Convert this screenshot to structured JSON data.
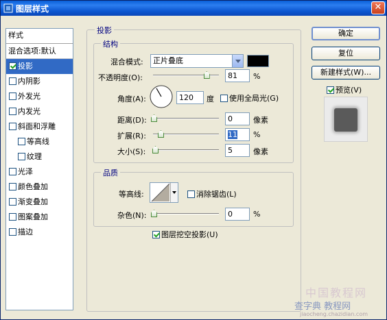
{
  "window": {
    "title": "图层样式",
    "close_glyph": "✕"
  },
  "style_list": {
    "header": "样式",
    "blend_options": "混合选项:默认",
    "items": [
      {
        "label": "投影",
        "checked": true,
        "active": true,
        "indent": false
      },
      {
        "label": "内阴影",
        "checked": false,
        "active": false,
        "indent": false
      },
      {
        "label": "外发光",
        "checked": false,
        "active": false,
        "indent": false
      },
      {
        "label": "内发光",
        "checked": false,
        "active": false,
        "indent": false
      },
      {
        "label": "斜面和浮雕",
        "checked": false,
        "active": false,
        "indent": false
      },
      {
        "label": "等高线",
        "checked": false,
        "active": false,
        "indent": true
      },
      {
        "label": "纹理",
        "checked": false,
        "active": false,
        "indent": true
      },
      {
        "label": "光泽",
        "checked": false,
        "active": false,
        "indent": false
      },
      {
        "label": "颜色叠加",
        "checked": false,
        "active": false,
        "indent": false
      },
      {
        "label": "渐变叠加",
        "checked": false,
        "active": false,
        "indent": false
      },
      {
        "label": "图案叠加",
        "checked": false,
        "active": false,
        "indent": false
      },
      {
        "label": "描边",
        "checked": false,
        "active": false,
        "indent": false
      }
    ]
  },
  "drop_shadow": {
    "legend": "投影",
    "structure": {
      "legend": "结构",
      "blend_mode_label": "混合模式:",
      "blend_mode_value": "正片叠底",
      "shadow_color": "#000000",
      "opacity_label": "不透明度(O):",
      "opacity_value": "81",
      "opacity_level": 0.81,
      "percent": "%",
      "angle_label": "角度(A):",
      "angle_value": "120",
      "angle_unit": "度",
      "global_light_label": "使用全局光(G)",
      "global_light_checked": false,
      "distance_label": "距离(D):",
      "distance_value": "0",
      "px_unit": "像素",
      "spread_label": "扩展(R):",
      "spread_value": "11",
      "size_label": "大小(S):",
      "size_value": "5"
    },
    "quality": {
      "legend": "品质",
      "contour_label": "等高线:",
      "anti_alias_label": "消除锯齿(L)",
      "anti_alias_checked": false,
      "noise_label": "杂色(N):",
      "noise_value": "0"
    },
    "knockout_label": "图层挖空投影(U)",
    "knockout_checked": true
  },
  "buttons": {
    "ok": "确定",
    "reset": "复位",
    "new_style": "新建样式(W)...",
    "preview_label": "预览(V)",
    "preview_checked": true
  },
  "watermark": {
    "line1": "中国教程网",
    "line2": "查字典 教程网",
    "line3": "jiaocheng.chazidian.com"
  }
}
